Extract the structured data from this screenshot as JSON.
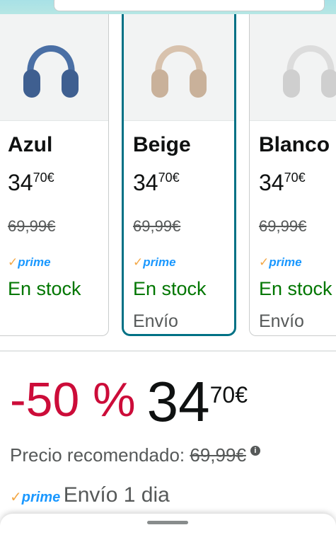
{
  "variants": [
    {
      "name": "Azul",
      "price_int": "34",
      "price_frac": "70€",
      "list_price": "69,99€",
      "prime": "prime",
      "stock": "En stock",
      "shipping": "",
      "color": "#4a6fa5"
    },
    {
      "name": "Beige",
      "price_int": "34",
      "price_frac": "70€",
      "list_price": "69,99€",
      "prime": "prime",
      "stock": "En stock",
      "shipping": "Envío",
      "color": "#d8c2ad"
    },
    {
      "name": "Blanco",
      "price_int": "34",
      "price_frac": "70€",
      "list_price": "69,99€",
      "prime": "prime",
      "stock": "En stock",
      "shipping": "Envío",
      "color": "#e4e4e4"
    }
  ],
  "deal": {
    "discount": "-50 %",
    "price_int": "34",
    "price_frac": "70€",
    "rrp_label": "Precio recomendado:",
    "rrp_value": "69,99€",
    "info_icon": "i",
    "prime": "prime",
    "prime_check": "✓",
    "shipping": "Envío 1 dia"
  },
  "colors": {
    "accent": "#007185",
    "discount": "#cc0c39",
    "in_stock": "#007600",
    "prime": "#1a98ff",
    "prime_check": "#f3a847"
  },
  "icons": {
    "variant_image": "headphones-icon",
    "info": "info-icon",
    "prime": "prime-logo"
  }
}
